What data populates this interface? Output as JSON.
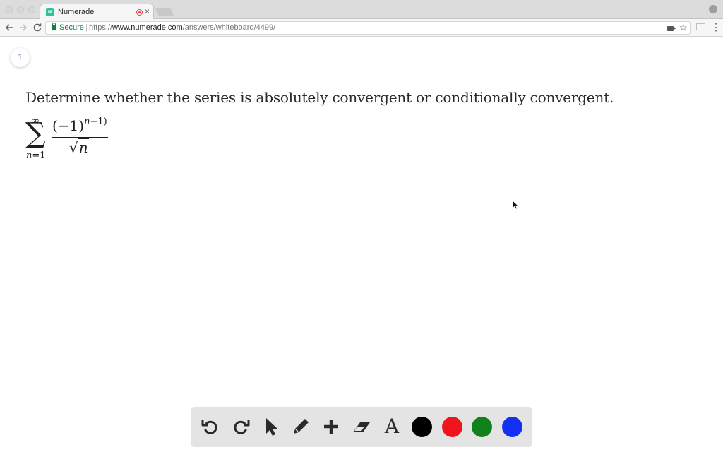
{
  "browser": {
    "tab_title": "Numerade",
    "tab_favicon_letter": "N",
    "close_glyph": "×",
    "secure_label": "Secure",
    "url_scheme": "https://",
    "url_host": "www.numerade.com",
    "url_path": "/answers/whiteboard/4499/"
  },
  "whiteboard": {
    "page_number": "1",
    "problem_text": "Determine whether the series is absolutely convergent or conditionally convergent.",
    "formula": {
      "sum_upper": "∞",
      "sum_symbol": "∑",
      "sum_lower_var": "n",
      "sum_lower_rest": "=1",
      "numerator_base": "(−1)",
      "numerator_exp_var": "n",
      "numerator_exp_rest": "−1)",
      "denominator_radical": "√",
      "denominator_radicand": "n"
    }
  },
  "toolbar": {
    "tools": [
      "undo-icon",
      "redo-icon",
      "pointer-icon",
      "pencil-icon",
      "plus-icon",
      "eraser-icon",
      "text-icon"
    ],
    "text_tool_glyph": "A",
    "colors": [
      "#000000",
      "#f0151c",
      "#11821b",
      "#1430f5"
    ]
  }
}
